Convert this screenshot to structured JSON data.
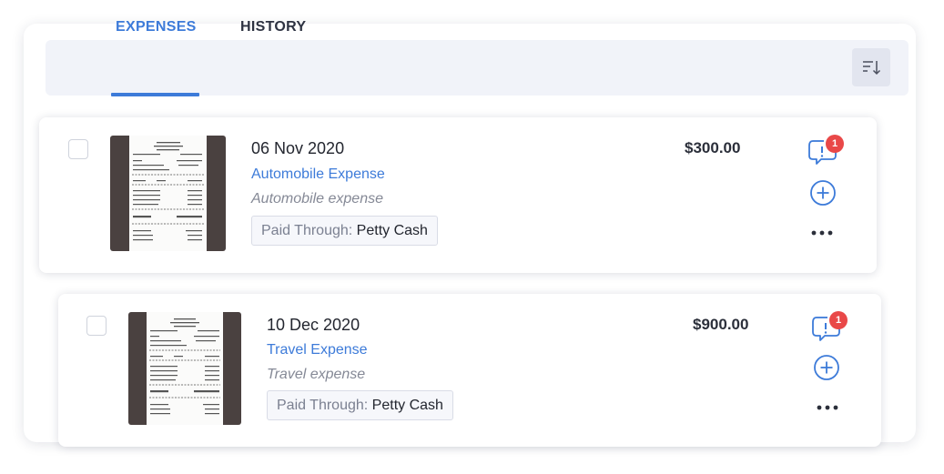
{
  "tabs": [
    {
      "label": "EXPENSES",
      "active": true
    },
    {
      "label": "HISTORY",
      "active": false
    }
  ],
  "sort_icon": "sort-descending-icon",
  "colors": {
    "accent": "#3d7bd9",
    "badge": "#e94848",
    "tabbar_bg": "#f1f3f9",
    "receipt_bg": "#4a4140"
  },
  "expenses": [
    {
      "date": "06 Nov 2020",
      "category": "Automobile Expense",
      "description": "Automobile expense",
      "paid_through_label": "Paid Through:",
      "paid_through_value": "Petty Cash",
      "amount": "$300.00",
      "alert_count": "1",
      "icons": [
        "receipt-thumbnail",
        "chat-alert-icon",
        "add-circle-icon",
        "more-options-icon"
      ]
    },
    {
      "date": "10 Dec 2020",
      "category": "Travel Expense",
      "description": "Travel expense",
      "paid_through_label": "Paid Through:",
      "paid_through_value": "Petty Cash",
      "amount": "$900.00",
      "alert_count": "1",
      "icons": [
        "receipt-thumbnail",
        "chat-alert-icon",
        "add-circle-icon",
        "more-options-icon"
      ]
    }
  ]
}
